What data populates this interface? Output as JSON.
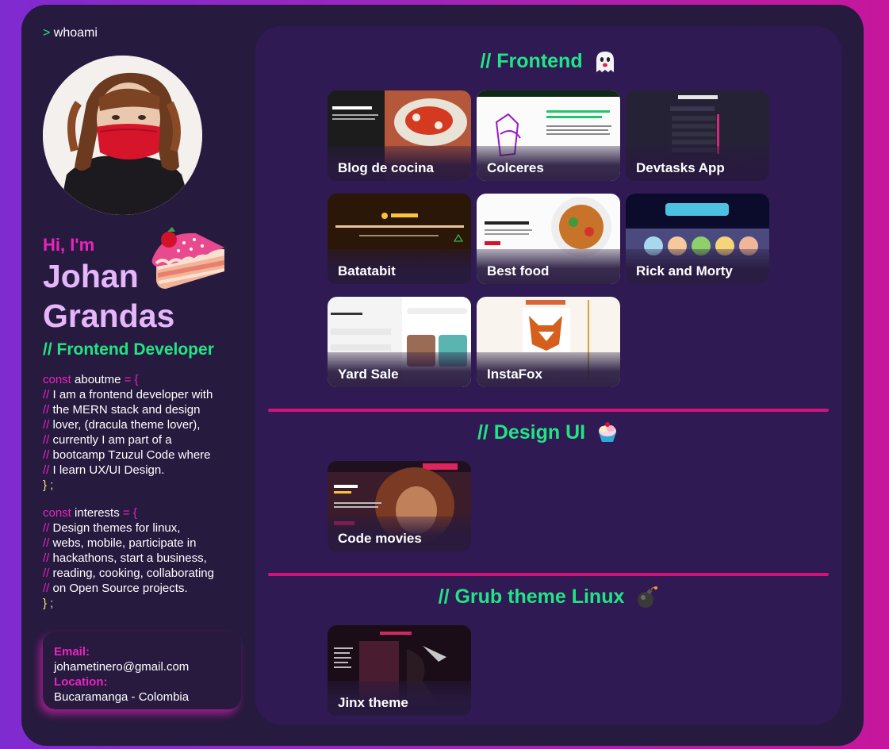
{
  "sidebar": {
    "prompt_symbol": ">",
    "prompt_text": "whoami",
    "greeting": "Hi, I'm",
    "first_name": "Johan",
    "last_name": "Grandas",
    "role": "// Frontend Developer",
    "aboutme": {
      "keyword": "const",
      "variable": "aboutme",
      "operator": "= {",
      "lines": [
        "// I am a frontend developer with",
        "// the MERN stack and design",
        "// lover, (dracula theme lover),",
        "// currently I am part of a",
        "// bootcamp Tzuzul Code where",
        "// I learn UX/UI Design."
      ],
      "close": "} ;"
    },
    "interests": {
      "keyword": "const",
      "variable": "interests",
      "operator": "= {",
      "lines": [
        "// Design themes for linux,",
        "// webs, mobile, participate in",
        "// hackathons, start a business,",
        "// reading, cooking, collaborating",
        "// on Open Source projects."
      ],
      "close": "} ;"
    },
    "contact": {
      "email_label": "Email:",
      "email": "johametinero@gmail.com",
      "location_label": "Location:",
      "location": "Bucaramanga - Colombia"
    }
  },
  "sections": {
    "frontend": {
      "title": "// Frontend",
      "emoji": "ghost",
      "projects": [
        "Blog de cocina",
        "Colceres",
        "Devtasks App",
        "Batatabit",
        "Best food",
        "Rick and Morty",
        "Yard Sale",
        "InstaFox"
      ]
    },
    "design": {
      "title": "// Design UI",
      "emoji": "ice-cream",
      "projects": [
        "Code movies"
      ]
    },
    "grub": {
      "title": "// Grub theme Linux",
      "emoji": "bomb",
      "projects": [
        "Jinx theme"
      ]
    }
  },
  "colors": {
    "accent_green": "#21e585",
    "accent_pink": "#ea23bf",
    "name_lavender": "#e6b6fb",
    "divider": "#d1127f",
    "panel": "#2f1a53",
    "frame": "#271a3f"
  }
}
